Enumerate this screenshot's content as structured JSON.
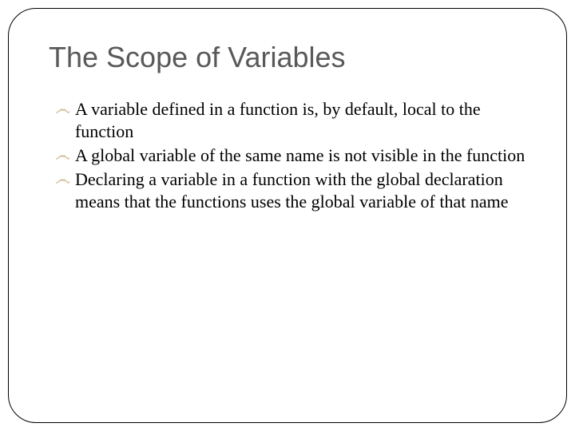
{
  "slide": {
    "title": "The Scope of Variables",
    "bullets": [
      "A variable defined in a function is, by default, local to the function",
      "A global variable of the same name is not visible in the function",
      "Declaring a variable in a function with the global declaration means that the functions uses the global variable of that name"
    ],
    "bullet_glyph": "෴"
  }
}
